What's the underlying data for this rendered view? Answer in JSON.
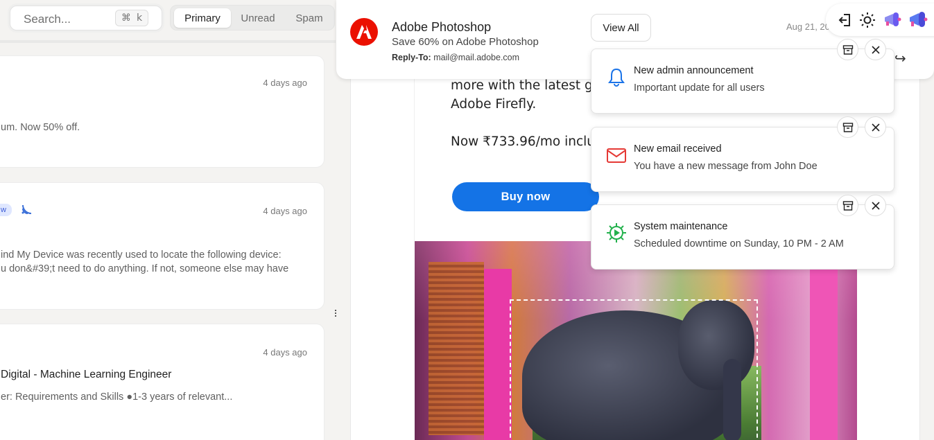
{
  "search": {
    "placeholder": "Search...",
    "shortcut_symbol": "⌘",
    "shortcut_key": "k"
  },
  "tabs": [
    {
      "label": "Primary",
      "active": true
    },
    {
      "label": "Unread",
      "active": false
    },
    {
      "label": "Spam",
      "active": false
    }
  ],
  "mail_list": [
    {
      "time": "4 days ago",
      "preview": "um. Now 50% off."
    },
    {
      "time": "4 days ago",
      "badge": "w",
      "preview_lines": [
        "ind My Device was recently used to locate the following device:",
        "u don&#39;t need to do anything. If not, someone else may have"
      ]
    },
    {
      "time": "4 days ago",
      "subject": "Digital - Machine Learning Engineer",
      "preview": "er: Requirements and Skills ●1-3 years of relevant..."
    }
  ],
  "email": {
    "sender": "Adobe Photoshop",
    "snippet": "Save 60% on Adobe Photoshop",
    "reply_to_label": "Reply-To:",
    "reply_to": "mail@mail.adobe.com",
    "date": "Aug 21, 20",
    "body_lines": [
      "more with the latest gen",
      "Adobe Firefly.",
      "Now ₹733.96/mo includ"
    ],
    "cta": "Buy now",
    "accent": "#1473e6",
    "brand_color": "#eb1000"
  },
  "view_all_label": "View All",
  "toolbar_icons": [
    "logout-icon",
    "sun-icon",
    "megaphone-icon",
    "megaphone-icon"
  ],
  "notifications": [
    {
      "icon": "bell-icon",
      "title": "New admin announcement",
      "message": "Important update for all users",
      "icon_color": "#1a73e8"
    },
    {
      "icon": "mail-icon",
      "title": "New email received",
      "message": "You have a new message from John Doe",
      "icon_color": "#e53935"
    },
    {
      "icon": "gear-play-icon",
      "title": "System maintenance",
      "message": "Scheduled downtime on Sunday, 10 PM - 2 AM",
      "icon_color": "#22b14c"
    }
  ]
}
